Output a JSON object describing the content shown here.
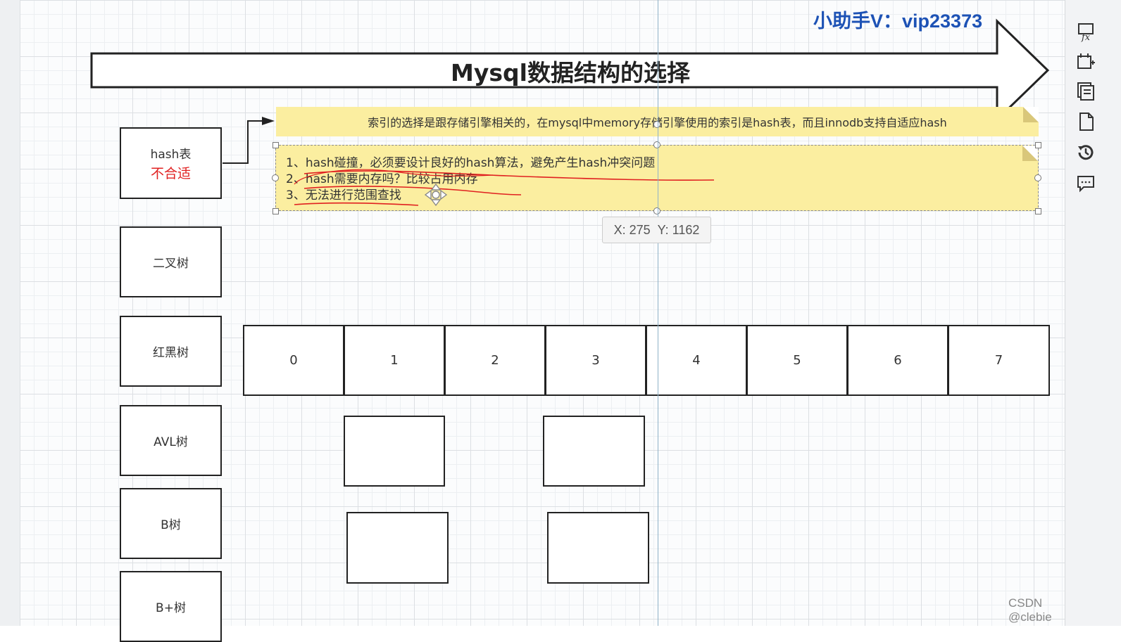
{
  "banner": {
    "title": "Mysql数据结构的选择"
  },
  "brand": {
    "text": "小助手V：vip23373"
  },
  "structures": [
    {
      "label": "hash表",
      "note": "不合适"
    },
    {
      "label": "二叉树"
    },
    {
      "label": "红黑树"
    },
    {
      "label": "AVL树"
    },
    {
      "label": "B树"
    },
    {
      "label": "B+树"
    }
  ],
  "note_top": {
    "text": "索引的选择是跟存储引擎相关的，在mysql中memory存储引擎使用的索引是hash表，而且innodb支持自适应hash"
  },
  "note_list": {
    "items": [
      "1、hash碰撞，必须要设计良好的hash算法，避免产生hash冲突问题",
      "2、hash需要内存吗？比较占用内存",
      "3、无法进行范围查找"
    ]
  },
  "array_cells": [
    "0",
    "1",
    "2",
    "3",
    "4",
    "5",
    "6",
    "7"
  ],
  "tooltip": {
    "x": "X: 275",
    "y": "Y: 1162"
  },
  "toolbar": {
    "icons": [
      "function-icon",
      "calendar-add-icon",
      "copy-pages-icon",
      "page-icon",
      "history-icon",
      "comment-icon"
    ]
  },
  "watermark": "CSDN @clebie",
  "colors": {
    "accent_red": "#e02020",
    "note_yellow": "#fbeea0",
    "brand_blue": "#1d52b5"
  }
}
